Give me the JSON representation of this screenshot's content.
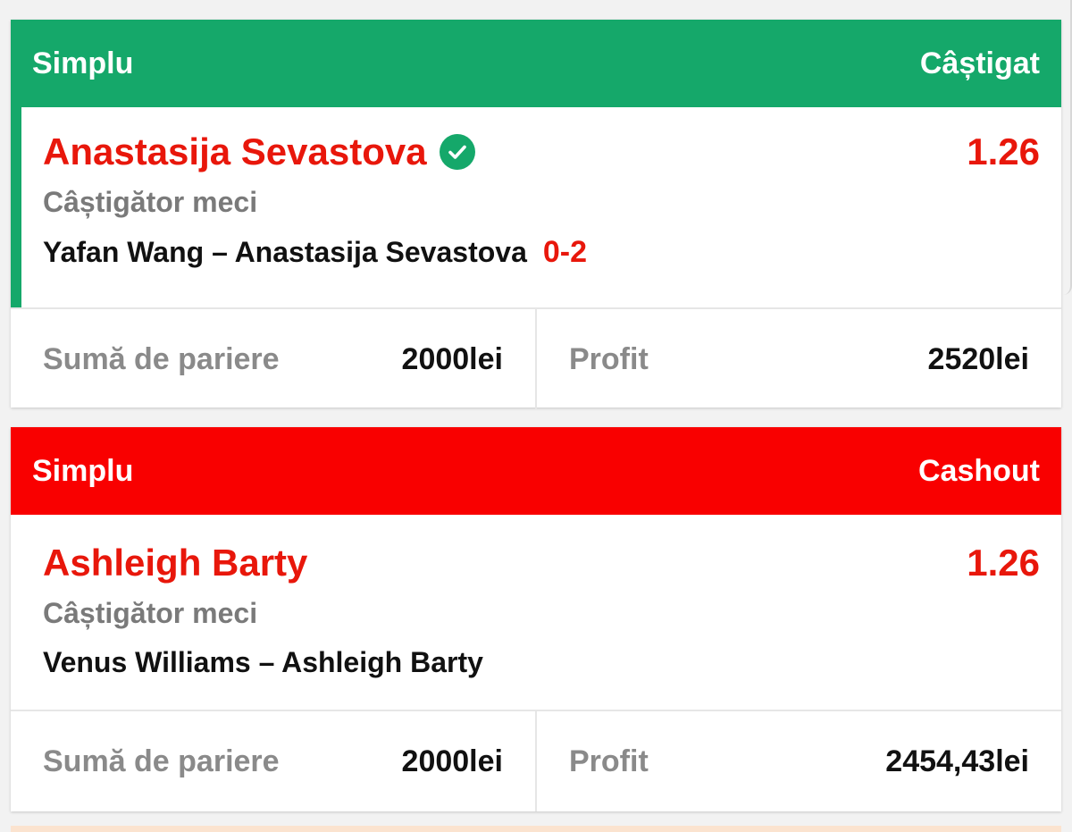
{
  "bets": [
    {
      "type_label": "Simplu",
      "status_label": "Câștigat",
      "header_color": "#15a86a",
      "selection": "Anastasija Sevastova",
      "selection_icon": "check-circle-icon",
      "odds": "1.26",
      "market": "Câștigător meci",
      "event": "Yafan Wang – Anastasija Sevastova",
      "score": "0-2",
      "stake_label": "Sumă de pariere",
      "stake_value": "2000lei",
      "profit_label": "Profit",
      "profit_value": "2520lei"
    },
    {
      "type_label": "Simplu",
      "status_label": "Cashout",
      "header_color": "#f90000",
      "selection": "Ashleigh Barty",
      "odds": "1.26",
      "market": "Câștigător meci",
      "event": "Venus Williams – Ashleigh Barty",
      "stake_label": "Sumă de pariere",
      "stake_value": "2000lei",
      "profit_label": "Profit",
      "profit_value": "2454,43lei"
    }
  ]
}
